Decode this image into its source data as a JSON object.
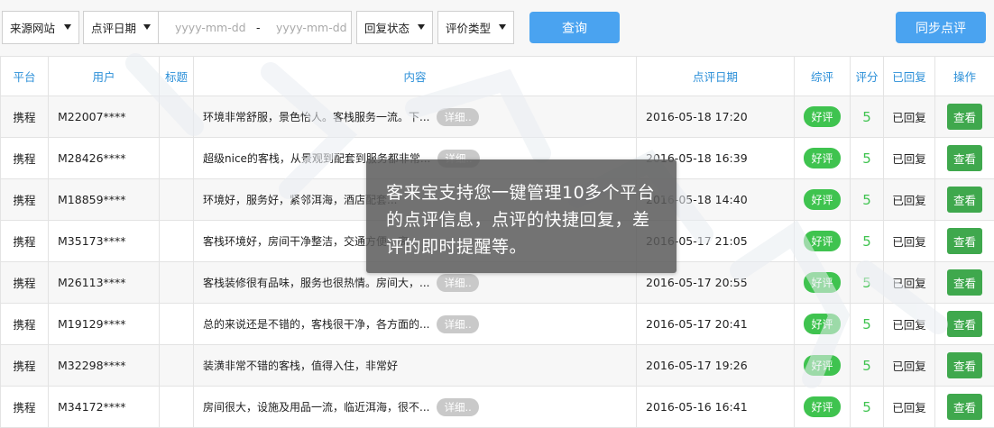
{
  "filters": {
    "source_site": "来源网站",
    "review_date": "点评日期",
    "date_placeholder_start": "yyyy-mm-dd",
    "date_separator": "-",
    "date_placeholder_end": "yyyy-mm-dd",
    "reply_status": "回复状态",
    "review_type": "评价类型",
    "query_label": "查询",
    "sync_label": "同步点评"
  },
  "table": {
    "headers": {
      "platform": "平台",
      "user": "用户",
      "title": "标题",
      "content": "内容",
      "date": "点评日期",
      "overall": "综评",
      "score": "评分",
      "replied": "已回复",
      "action": "操作"
    },
    "more_label": "详细..",
    "rows": [
      {
        "platform": "携程",
        "user": "M22007****",
        "title": "",
        "content": "环境非常舒服，景色怡人。客栈服务一流。下...",
        "has_more": true,
        "date": "2016-05-18 17:20",
        "tag": "好评",
        "score": "5",
        "replied": "已回复",
        "action": "查看"
      },
      {
        "platform": "携程",
        "user": "M28426****",
        "title": "",
        "content": "超级nice的客栈，从景观到配套到服务都非常...",
        "has_more": true,
        "date": "2016-05-18 16:39",
        "tag": "好评",
        "score": "5",
        "replied": "已回复",
        "action": "查看"
      },
      {
        "platform": "携程",
        "user": "M18859****",
        "title": "",
        "content": "环境好，服务好，紧邻洱海，酒店配套...",
        "has_more": false,
        "date": "2016-05-18 14:40",
        "tag": "好评",
        "score": "5",
        "replied": "已回复",
        "action": "查看"
      },
      {
        "platform": "携程",
        "user": "M35173****",
        "title": "",
        "content": "客栈环境好，房间干净整洁，交通方便，离...",
        "has_more": false,
        "date": "2016-05-17 21:05",
        "tag": "好评",
        "score": "5",
        "replied": "已回复",
        "action": "查看"
      },
      {
        "platform": "携程",
        "user": "M26113****",
        "title": "",
        "content": "客栈装修很有品味，服务也很热情。房间大，...",
        "has_more": true,
        "date": "2016-05-17 20:55",
        "tag": "好评",
        "score": "5",
        "replied": "已回复",
        "action": "查看"
      },
      {
        "platform": "携程",
        "user": "M19129****",
        "title": "",
        "content": "总的来说还是不错的，客栈很干净，各方面的...",
        "has_more": true,
        "date": "2016-05-17 20:41",
        "tag": "好评",
        "score": "5",
        "replied": "已回复",
        "action": "查看"
      },
      {
        "platform": "携程",
        "user": "M32298****",
        "title": "",
        "content": "装潢非常不错的客栈，值得入住，非常好",
        "has_more": false,
        "date": "2016-05-17 19:26",
        "tag": "好评",
        "score": "5",
        "replied": "已回复",
        "action": "查看"
      },
      {
        "platform": "携程",
        "user": "M34172****",
        "title": "",
        "content": "房间很大，设施及用品一流，临近洱海，很不...",
        "has_more": true,
        "date": "2016-05-16 16:41",
        "tag": "好评",
        "score": "5",
        "replied": "已回复",
        "action": "查看"
      }
    ]
  },
  "tooltip": {
    "text": "客来宝支持您一键管理10多个平台的点评信息，点评的快捷回复，差评的即时提醒等。"
  },
  "colors": {
    "accent_blue": "#4aa3f0",
    "header_text": "#2b8fd8",
    "good_green": "#3fc34f",
    "view_button": "#3fa84d"
  }
}
